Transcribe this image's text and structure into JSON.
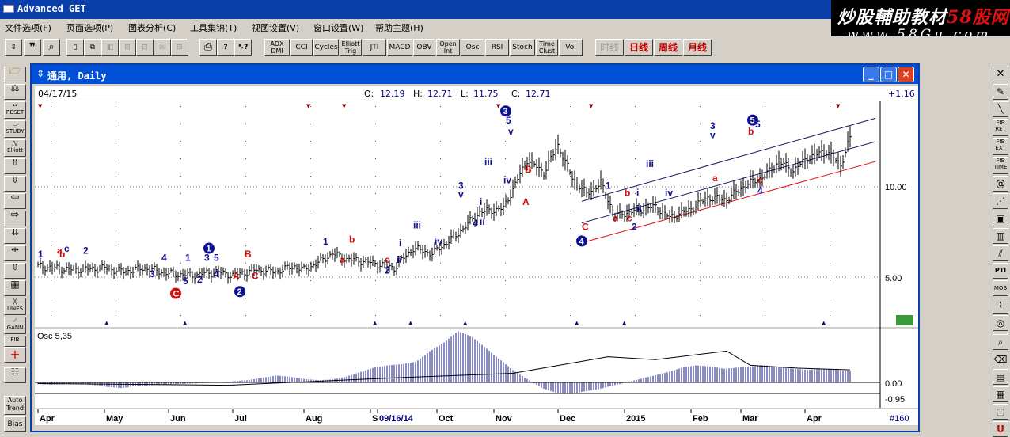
{
  "app": {
    "title": "Advanced GET"
  },
  "watermark": {
    "line1_a": "炒股輔助教材",
    "line1_b": "58股网",
    "line2": "www.58Gu.com"
  },
  "menu": [
    "文件选项(F)",
    "页面选项(P)",
    "图表分析(C)",
    "工具集锦(T)",
    "视图设置(V)",
    "窗口设置(W)",
    "帮助主题(H)"
  ],
  "toolbar": {
    "buttons": [
      "ADX DMI",
      "CCI",
      "Cycles",
      "Elliott Trig",
      "JTI",
      "MACD",
      "OBV",
      "Open Int",
      "Osc",
      "RSI",
      "Stoch",
      "Time Clust",
      "Vol"
    ],
    "period": [
      "时线",
      "日线",
      "周线",
      "月线"
    ]
  },
  "left_tools": [
    "RESET",
    "STUDY",
    "Elliott",
    "LINES",
    "GANN",
    "FIB",
    "Auto Trend",
    "Bias"
  ],
  "right_tools": [
    "FIB RET",
    "FIB EXT",
    "FIB TIME",
    "PTI",
    "MOB",
    "U"
  ],
  "window": {
    "title": "通用, Daily"
  },
  "info": {
    "date": "04/17/15",
    "open_label": "O:",
    "open": "12.19",
    "high_label": "H:",
    "high": "12.71",
    "low_label": "L:",
    "low": "11.75",
    "close_label": "C:",
    "close": "12.71",
    "change": "+1.16"
  },
  "chart_data": {
    "type": "bar",
    "title": "通用, Daily",
    "price_axis": {
      "ticks": [
        "10.00",
        "5.00"
      ],
      "ylim": [
        2.5,
        15.5
      ]
    },
    "osc_axis": {
      "ticks": [
        "0.00",
        "-0.95"
      ]
    },
    "osc_label": "Osc 5,35",
    "x_axis": {
      "labels": [
        "Apr",
        "May",
        "Jun",
        "Jul",
        "Aug",
        "S",
        "09/16/14",
        "Oct",
        "Nov",
        "Dec",
        "2015",
        "Feb",
        "Mar",
        "Apr"
      ]
    },
    "bar_counter": "#160",
    "price_path": [
      [
        0,
        5.6
      ],
      [
        15,
        5.4
      ],
      [
        28,
        5.5
      ],
      [
        36,
        5.3
      ],
      [
        45,
        5.5
      ],
      [
        55,
        5.2
      ],
      [
        65,
        5.1
      ],
      [
        75,
        5.3
      ],
      [
        82,
        5.1
      ],
      [
        92,
        5.4
      ],
      [
        100,
        5.3
      ],
      [
        108,
        5.6
      ],
      [
        112,
        5.4
      ],
      [
        118,
        5.8
      ],
      [
        124,
        6.3
      ],
      [
        130,
        6.0
      ],
      [
        136,
        5.9
      ],
      [
        144,
        5.7
      ],
      [
        150,
        5.5
      ],
      [
        158,
        6.6
      ],
      [
        166,
        6.3
      ],
      [
        176,
        7.3
      ],
      [
        186,
        8.6
      ],
      [
        196,
        8.8
      ],
      [
        206,
        11.5
      ],
      [
        213,
        10.8
      ],
      [
        219,
        12.3
      ],
      [
        225,
        10.5
      ],
      [
        231,
        9.6
      ],
      [
        237,
        10.2
      ],
      [
        243,
        8.4
      ],
      [
        252,
        8.7
      ],
      [
        260,
        8.9
      ],
      [
        266,
        8.3
      ],
      [
        274,
        8.7
      ],
      [
        282,
        9.4
      ],
      [
        290,
        9.3
      ],
      [
        298,
        10.1
      ],
      [
        306,
        10.6
      ],
      [
        312,
        11.4
      ],
      [
        318,
        10.9
      ],
      [
        324,
        11.6
      ],
      [
        332,
        12.0
      ],
      [
        338,
        11.2
      ],
      [
        342,
        12.7
      ]
    ],
    "osc_values": [
      -3,
      -4,
      -3,
      -2,
      -5,
      -8,
      -10,
      -6,
      -5,
      -4,
      -3,
      -2,
      -1,
      0,
      2,
      4,
      8,
      12,
      10,
      6,
      4,
      5,
      10,
      18,
      26,
      30,
      32,
      36,
      55,
      70,
      90,
      80,
      60,
      40,
      20,
      5,
      -10,
      -18,
      -20,
      -16,
      -12,
      -6,
      0,
      6,
      12,
      18,
      26,
      30,
      28,
      24,
      26,
      28,
      30,
      26,
      24,
      22,
      24,
      22,
      20
    ],
    "osc_signal": [
      [
        0,
        -2
      ],
      [
        80,
        -5
      ],
      [
        150,
        8
      ],
      [
        200,
        16
      ],
      [
        240,
        45
      ],
      [
        260,
        40
      ],
      [
        290,
        55
      ],
      [
        300,
        30
      ],
      [
        320,
        25
      ],
      [
        342,
        22
      ]
    ],
    "wave_labels": [
      {
        "t": "1",
        "x": 0,
        "y": 6.1,
        "c": "navy"
      },
      {
        "t": "a",
        "x": 8,
        "y": 6.3,
        "c": "red"
      },
      {
        "t": "c",
        "x": 11,
        "y": 6.4,
        "c": "navy"
      },
      {
        "t": "b",
        "x": 9,
        "y": 6.1,
        "c": "red"
      },
      {
        "t": "2",
        "x": 19,
        "y": 6.3,
        "c": "navy"
      },
      {
        "t": "3",
        "x": 47,
        "y": 5.0,
        "c": "navy"
      },
      {
        "t": "4",
        "x": 52,
        "y": 5.9,
        "c": "navy"
      },
      {
        "t": "1",
        "x": 62,
        "y": 5.9,
        "c": "navy"
      },
      {
        "t": "5",
        "x": 61,
        "y": 4.6,
        "c": "navy"
      },
      {
        "t": "2",
        "x": 67,
        "y": 4.7,
        "c": "navy"
      },
      {
        "t": "3",
        "x": 70,
        "y": 5.9,
        "c": "navy"
      },
      {
        "t": "5",
        "x": 74,
        "y": 5.9,
        "c": "navy"
      },
      {
        "t": "4",
        "x": 74,
        "y": 5.0,
        "c": "navy"
      },
      {
        "t": "B",
        "x": 87,
        "y": 6.1,
        "c": "red"
      },
      {
        "t": "A",
        "x": 82,
        "y": 4.9,
        "c": "red"
      },
      {
        "t": "C",
        "x": 90,
        "y": 4.9,
        "c": "red"
      },
      {
        "t": "1",
        "x": 120,
        "y": 6.8,
        "c": "navy"
      },
      {
        "t": "a",
        "x": 127,
        "y": 5.8,
        "c": "red"
      },
      {
        "t": "b",
        "x": 131,
        "y": 6.9,
        "c": "red"
      },
      {
        "t": "c",
        "x": 146,
        "y": 5.8,
        "c": "red"
      },
      {
        "t": "2",
        "x": 146,
        "y": 5.2,
        "c": "navy"
      },
      {
        "t": "i",
        "x": 152,
        "y": 6.7,
        "c": "navy"
      },
      {
        "t": "ii",
        "x": 151,
        "y": 5.8,
        "c": "navy"
      },
      {
        "t": "iii",
        "x": 158,
        "y": 7.7,
        "c": "navy"
      },
      {
        "t": "iv",
        "x": 167,
        "y": 6.8,
        "c": "navy"
      },
      {
        "t": "3",
        "x": 177,
        "y": 9.9,
        "c": "navy"
      },
      {
        "t": "v",
        "x": 177,
        "y": 9.4,
        "c": "navy"
      },
      {
        "t": "4",
        "x": 183,
        "y": 7.8,
        "c": "navy"
      },
      {
        "t": "i",
        "x": 186,
        "y": 9.0,
        "c": "navy"
      },
      {
        "t": "ii",
        "x": 186,
        "y": 7.9,
        "c": "navy"
      },
      {
        "t": "iii",
        "x": 188,
        "y": 11.2,
        "c": "navy"
      },
      {
        "t": "iv",
        "x": 196,
        "y": 10.2,
        "c": "navy"
      },
      {
        "t": "5",
        "x": 197,
        "y": 13.5,
        "c": "navy"
      },
      {
        "t": "v",
        "x": 198,
        "y": 12.9,
        "c": "navy"
      },
      {
        "t": "B",
        "x": 205,
        "y": 10.8,
        "c": "red"
      },
      {
        "t": "A",
        "x": 204,
        "y": 9.0,
        "c": "red"
      },
      {
        "t": "C",
        "x": 229,
        "y": 7.6,
        "c": "red"
      },
      {
        "t": "1",
        "x": 239,
        "y": 9.9,
        "c": "navy"
      },
      {
        "t": "b",
        "x": 247,
        "y": 9.5,
        "c": "red"
      },
      {
        "t": "a",
        "x": 242,
        "y": 8.1,
        "c": "red"
      },
      {
        "t": "c",
        "x": 248,
        "y": 8.1,
        "c": "red"
      },
      {
        "t": "2",
        "x": 250,
        "y": 7.6,
        "c": "navy"
      },
      {
        "t": "i",
        "x": 252,
        "y": 9.5,
        "c": "navy"
      },
      {
        "t": "ii",
        "x": 252,
        "y": 8.6,
        "c": "navy"
      },
      {
        "t": "iii",
        "x": 256,
        "y": 11.1,
        "c": "navy"
      },
      {
        "t": "iv",
        "x": 264,
        "y": 9.5,
        "c": "navy"
      },
      {
        "t": "3",
        "x": 283,
        "y": 13.2,
        "c": "navy"
      },
      {
        "t": "v",
        "x": 283,
        "y": 12.7,
        "c": "navy"
      },
      {
        "t": "a",
        "x": 284,
        "y": 10.3,
        "c": "red"
      },
      {
        "t": "b",
        "x": 299,
        "y": 12.9,
        "c": "red"
      },
      {
        "t": "5",
        "x": 302,
        "y": 13.3,
        "c": "navy"
      },
      {
        "t": "c",
        "x": 303,
        "y": 10.2,
        "c": "red"
      },
      {
        "t": "4",
        "x": 303,
        "y": 9.6,
        "c": "navy"
      }
    ],
    "circle_labels": [
      {
        "t": "1",
        "x": 72,
        "y": 6.6,
        "c": "navy"
      },
      {
        "t": "C",
        "x": 58,
        "y": 4.1,
        "c": "red"
      },
      {
        "t": "2",
        "x": 85,
        "y": 4.2,
        "c": "navy"
      },
      {
        "t": "3",
        "x": 197,
        "y": 14.2,
        "c": "navy"
      },
      {
        "t": "4",
        "x": 229,
        "y": 7.0,
        "c": "navy"
      },
      {
        "t": "5",
        "x": 301,
        "y": 13.7,
        "c": "navy"
      }
    ]
  }
}
